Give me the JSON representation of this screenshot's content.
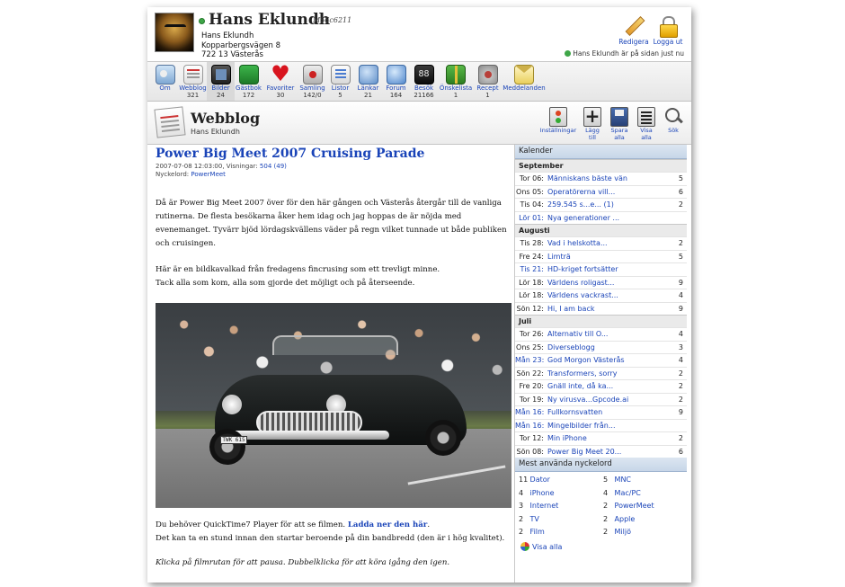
{
  "profile": {
    "name": "Hans Eklundh",
    "code": "M56c6211",
    "address_name": "Hans Eklundh",
    "address_street": "Kopparbergsvägen 8",
    "address_city": "722 13 Västerås",
    "edit_label": "Redigera",
    "logout_label": "Logga ut",
    "status_text": "Hans Eklundh är på sidan just nu"
  },
  "nav": [
    {
      "label": "Om",
      "count": "",
      "icon": "info-card-icon"
    },
    {
      "label": "Webblog",
      "count": "321",
      "icon": "blog-icon"
    },
    {
      "label": "Bilder",
      "count": "24",
      "icon": "photo-icon"
    },
    {
      "label": "Gästbok",
      "count": "172",
      "icon": "guestbook-icon"
    },
    {
      "label": "Favoriter",
      "count": "30",
      "icon": "heart-icon"
    },
    {
      "label": "Samling",
      "count": "142/0",
      "icon": "collection-icon"
    },
    {
      "label": "Listor",
      "count": "5",
      "icon": "list-icon"
    },
    {
      "label": "Länkar",
      "count": "21",
      "icon": "globe-icon"
    },
    {
      "label": "Forum",
      "count": "164",
      "icon": "chat-bubble-icon"
    },
    {
      "label": "Besök",
      "count": "21166",
      "icon": "counter-icon"
    },
    {
      "label": "Önskelista",
      "count": "1",
      "icon": "gift-icon"
    },
    {
      "label": "Recept",
      "count": "1",
      "icon": "dish-icon"
    },
    {
      "label": "Meddelanden",
      "count": "",
      "icon": "envelope-icon"
    }
  ],
  "section": {
    "title": "Webblog",
    "subtitle": "Hans Eklundh",
    "tools": {
      "settings": "Inställningar",
      "add_1": "Lägg",
      "add_2": "till",
      "save_1": "Spara",
      "save_2": "alla",
      "show_1": "Visa",
      "show_2": "alla",
      "search": "Sök"
    }
  },
  "post": {
    "title": "Power Big Meet 2007 Cruising Parade",
    "date": "2007-07-08 12:03:00, Visningar:",
    "views": "504",
    "views_extra": "(49)",
    "keyword_label": "Nyckelord:",
    "keyword": "PowerMeet",
    "para1": "Då är Power Big Meet 2007 över för den här gången och Västerås återgår till de vanliga rutinerna. De flesta besökarna åker hem idag och jag hoppas de är nöjda med evenemanget. Tyvärr bjöd lördagskvällens väder på regn vilket tunnade ut både publiken och cruisingen.",
    "para2a": "Här är en bildkavalkad från fredagens fincrusing som ett trevligt minne.",
    "para2b": "Tack alla som kom, alla som gjorde det möjligt och på återseende.",
    "plate": "TWK 615",
    "quicktime_text": "Du behöver QuickTime7 Player för att se filmen.",
    "download_link": "Ladda ner den här",
    "download_after": ".",
    "bandwidth_text": "Det kan ta en stund innan den startar beroende på din bandbredd (den är i hög kvalitet).",
    "italic_text": "Klicka på filmrutan för att pausa. Dubbelklicka för att köra igång den igen."
  },
  "sidebar": {
    "calendar_title": "Kalender",
    "months": [
      {
        "name": "September",
        "rows": [
          {
            "day": "Tor 06:",
            "title": "Människans bäste vän",
            "count": "5",
            "hl": false
          },
          {
            "day": "Ons 05:",
            "title": "Operatörerna vill...",
            "count": "6",
            "hl": false
          },
          {
            "day": "Tis 04:",
            "title": "259.545 s...e... (1)",
            "count": "2",
            "hl": false
          },
          {
            "day": "Lör 01:",
            "title": "Nya generationer ...",
            "count": "",
            "hl": true
          }
        ]
      },
      {
        "name": "Augusti",
        "rows": [
          {
            "day": "Tis 28:",
            "title": "Vad i helskotta...",
            "count": "2",
            "hl": false
          },
          {
            "day": "Fre 24:",
            "title": "Limträ",
            "count": "5",
            "hl": false
          },
          {
            "day": "Tis 21:",
            "title": "HD-kriget fortsätter",
            "count": "",
            "hl": true
          },
          {
            "day": "Lör 18:",
            "title": "Världens roligast...",
            "count": "9",
            "hl": false
          },
          {
            "day": "Lör 18:",
            "title": "Världens vackrast...",
            "count": "4",
            "hl": false
          },
          {
            "day": "Sön 12:",
            "title": "Hi, I am back",
            "count": "9",
            "hl": false
          }
        ]
      },
      {
        "name": "Juli",
        "rows": [
          {
            "day": "Tor 26:",
            "title": "Alternativ till O...",
            "count": "4",
            "hl": false
          },
          {
            "day": "Ons 25:",
            "title": "Diverseblogg",
            "count": "3",
            "hl": false
          },
          {
            "day": "Mån 23:",
            "title": "God Morgon Västerås",
            "count": "4",
            "hl": true
          },
          {
            "day": "Sön 22:",
            "title": "Transformers, sorry",
            "count": "2",
            "hl": false
          },
          {
            "day": "Fre 20:",
            "title": "Gnäll inte, då ka...",
            "count": "2",
            "hl": false
          },
          {
            "day": "Tor 19:",
            "title": "Ny virusva...Gpcode.ai",
            "count": "2",
            "hl": false
          },
          {
            "day": "Mån 16:",
            "title": "Fullkornsvatten",
            "count": "9",
            "hl": true
          },
          {
            "day": "Mån 16:",
            "title": "Mingelbilder från...",
            "count": "",
            "hl": true
          },
          {
            "day": "Tor 12:",
            "title": "Min iPhone",
            "count": "2",
            "hl": false
          },
          {
            "day": "Sön 08:",
            "title": "Power Big Meet 20...",
            "count": "6",
            "hl": false
          }
        ]
      }
    ],
    "keywords_title": "Mest använda nyckelord",
    "keywords": [
      {
        "count": "11",
        "word": "Dator"
      },
      {
        "count": "5",
        "word": "MNC"
      },
      {
        "count": "4",
        "word": "iPhone"
      },
      {
        "count": "4",
        "word": "Mac/PC"
      },
      {
        "count": "3",
        "word": "Internet"
      },
      {
        "count": "2",
        "word": "PowerMeet"
      },
      {
        "count": "2",
        "word": "TV"
      },
      {
        "count": "2",
        "word": "Apple"
      },
      {
        "count": "2",
        "word": "Film"
      },
      {
        "count": "2",
        "word": "Miljö"
      }
    ],
    "show_all": "Visa alla"
  }
}
